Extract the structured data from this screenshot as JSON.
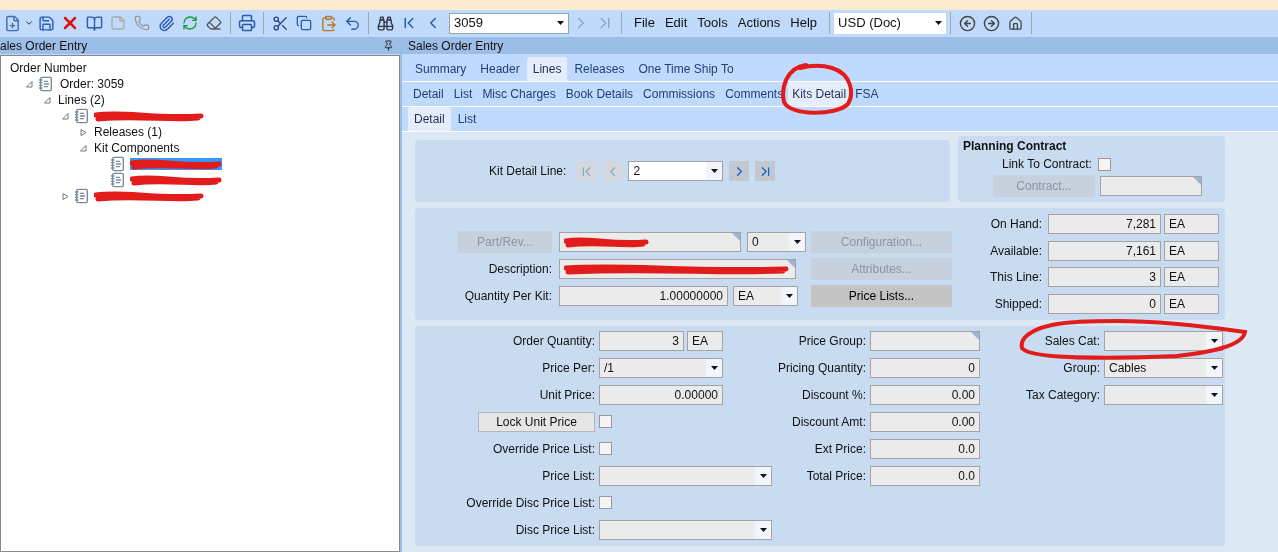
{
  "toolbar": {
    "order_number": "3059",
    "menu": [
      "File",
      "Edit",
      "Tools",
      "Actions",
      "Help"
    ],
    "currency": "USD (Doc)"
  },
  "tree_panel": {
    "title": "ales Order Entry",
    "nodes": [
      {
        "label": "Order Number",
        "kind": "header",
        "selected": false,
        "children": [
          {
            "label": "Order: 3059",
            "kind": "record",
            "expanded": true,
            "selected": false,
            "children": [
              {
                "label": "Lines (2)",
                "kind": "group",
                "expanded": true,
                "selected": false,
                "children": [
                  {
                    "kind": "record",
                    "expanded": true,
                    "selected": false,
                    "children": [
                      {
                        "label": "Releases (1)",
                        "kind": "group",
                        "expanded": false,
                        "selected": false
                      },
                      {
                        "label": "Kit Components",
                        "kind": "group",
                        "expanded": true,
                        "selected": false,
                        "children": [
                          {
                            "kind": "record",
                            "selected": true
                          },
                          {
                            "kind": "record",
                            "selected": false
                          }
                        ]
                      }
                    ]
                  },
                  {
                    "kind": "record",
                    "expanded": false,
                    "selected": false
                  }
                ]
              }
            ]
          }
        ]
      }
    ]
  },
  "main": {
    "title": "Sales Order Entry",
    "tab_rows": [
      [
        {
          "label": "Summary",
          "selected": false
        },
        {
          "label": "Header",
          "selected": false
        },
        {
          "label": "Lines",
          "selected": true
        },
        {
          "label": "Releases",
          "selected": false
        },
        {
          "label": "One Time Ship To",
          "selected": false
        }
      ],
      [
        {
          "label": "Detail",
          "selected": false
        },
        {
          "label": "List",
          "selected": false
        },
        {
          "label": "Misc Charges",
          "selected": false
        },
        {
          "label": "Book Details",
          "selected": false
        },
        {
          "label": "Commissions",
          "selected": false
        },
        {
          "label": "Comments",
          "selected": false
        },
        {
          "label": "Kits Detail",
          "selected": true
        },
        {
          "label": "FSA",
          "selected": false
        }
      ],
      [
        {
          "label": "Detail",
          "selected": true
        },
        {
          "label": "List",
          "selected": false
        }
      ]
    ],
    "kit_detail_line": {
      "label": "Kit Detail Line:",
      "value": "2"
    },
    "planning_contract": {
      "title": "Planning Contract",
      "link_label": "Link To Contract:",
      "link_checked": false,
      "contract_button": "Contract..."
    },
    "part": {
      "part_button": "Part/Rev...",
      "revision": "0",
      "configuration_button": "Configuration...",
      "description_label": "Description:",
      "attributes_button": "Attributes...",
      "quantity_label": "Quantity Per Kit:",
      "quantity": "1.00000000",
      "uom": "EA",
      "price_lists_button": "Price Lists..."
    },
    "inventory": [
      {
        "label": "On Hand:",
        "value": "7,281",
        "uom": "EA"
      },
      {
        "label": "Available:",
        "value": "7,161",
        "uom": "EA"
      },
      {
        "label": "This Line:",
        "value": "3",
        "uom": "EA"
      },
      {
        "label": "Shipped:",
        "value": "0",
        "uom": "EA"
      }
    ],
    "pricing_columns": [
      [
        {
          "kind": "number",
          "label": "Order Quantity:",
          "value": "3",
          "uom": "EA"
        },
        {
          "kind": "dropdown",
          "label": "Price Per:",
          "value": "/1"
        },
        {
          "kind": "number",
          "label": "Unit Price:",
          "value": "0.00000"
        },
        {
          "kind": "button",
          "label": "Lock Unit Price",
          "checked": false
        },
        {
          "kind": "checkbox",
          "label": "Override Price List:",
          "checked": false
        },
        {
          "kind": "wide_dropdown",
          "label": "Price List:"
        },
        {
          "kind": "checkbox",
          "label": "Override Disc Price List:",
          "checked": false
        },
        {
          "kind": "wide_dropdown",
          "label": "Disc Price List:"
        }
      ],
      [
        {
          "kind": "text",
          "label": "Price Group:"
        },
        {
          "kind": "number",
          "label": "Pricing Quantity:",
          "value": "0"
        },
        {
          "kind": "number",
          "label": "Discount %:",
          "value": "0.00"
        },
        {
          "kind": "number",
          "label": "Discount Amt:",
          "value": "0.00"
        },
        {
          "kind": "number",
          "label": "Ext Price:",
          "value": "0.0"
        },
        {
          "kind": "number",
          "label": "Total Price:",
          "value": "0.0"
        }
      ],
      [
        {
          "kind": "dropdown",
          "label": "Sales Cat:"
        },
        {
          "kind": "dropdown",
          "label": "Group:",
          "value": "Cables"
        },
        {
          "kind": "dropdown",
          "label": "Tax Category:"
        }
      ]
    ]
  }
}
